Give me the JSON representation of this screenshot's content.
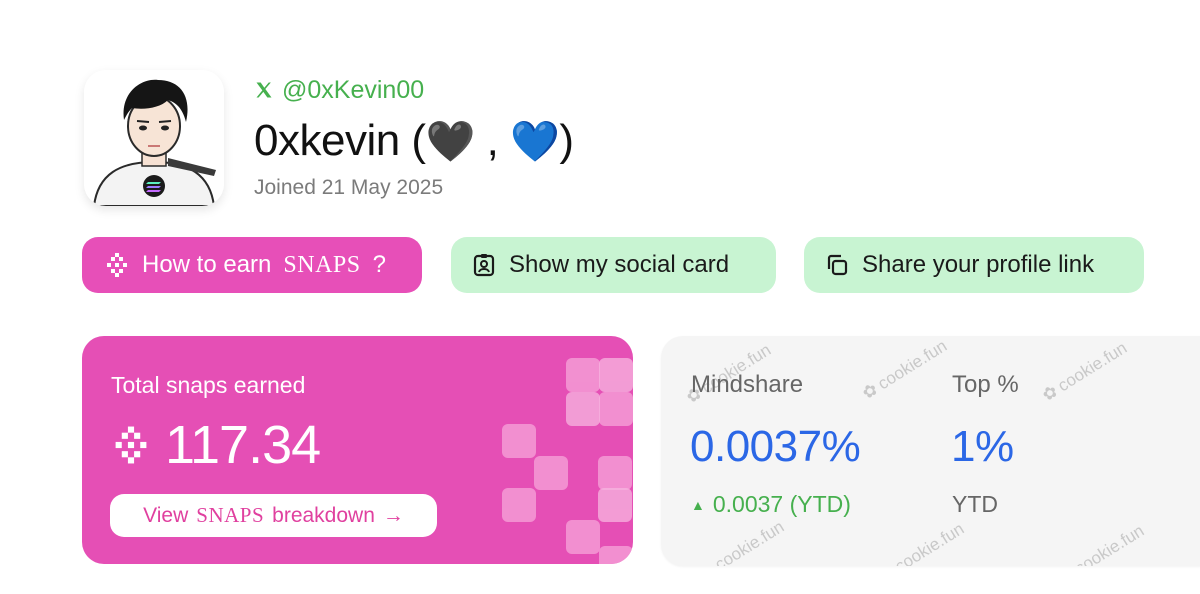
{
  "profile": {
    "handle": "@0xKevin00",
    "name": "0xkevin",
    "name_open": "(",
    "heart_black": "🖤",
    "separator": ",",
    "heart_blue": "💙",
    "name_close": ")",
    "joined": "Joined 21 May 2025"
  },
  "actions": {
    "earn_prefix": "How to earn",
    "earn_snaps": "SNAPS",
    "earn_suffix": "?",
    "social_card": "Show my social card",
    "share_link": "Share your profile link"
  },
  "snaps_card": {
    "label": "Total snaps earned",
    "total": "117.34",
    "breakdown_prefix": "View",
    "breakdown_snaps": "SNAPS",
    "breakdown_suffix": "breakdown",
    "arrow": "→"
  },
  "mindshare": {
    "label": "Mindshare",
    "value": "0.0037%",
    "delta_arrow": "▲",
    "delta": "0.0037 (YTD)",
    "top_label": "Top %",
    "top_value": "1%",
    "top_period": "YTD",
    "watermark": "cookie.fun"
  },
  "colors": {
    "pink": "#e54fb5",
    "mint": "#c8f4d2",
    "blue": "#2b67e6",
    "green": "#46b04e"
  },
  "icons": {
    "x": "x-logo-icon",
    "snaps": "snaps-icon",
    "social_card": "id-badge-icon",
    "share": "copy-icon",
    "arrow": "arrow-right-icon"
  }
}
